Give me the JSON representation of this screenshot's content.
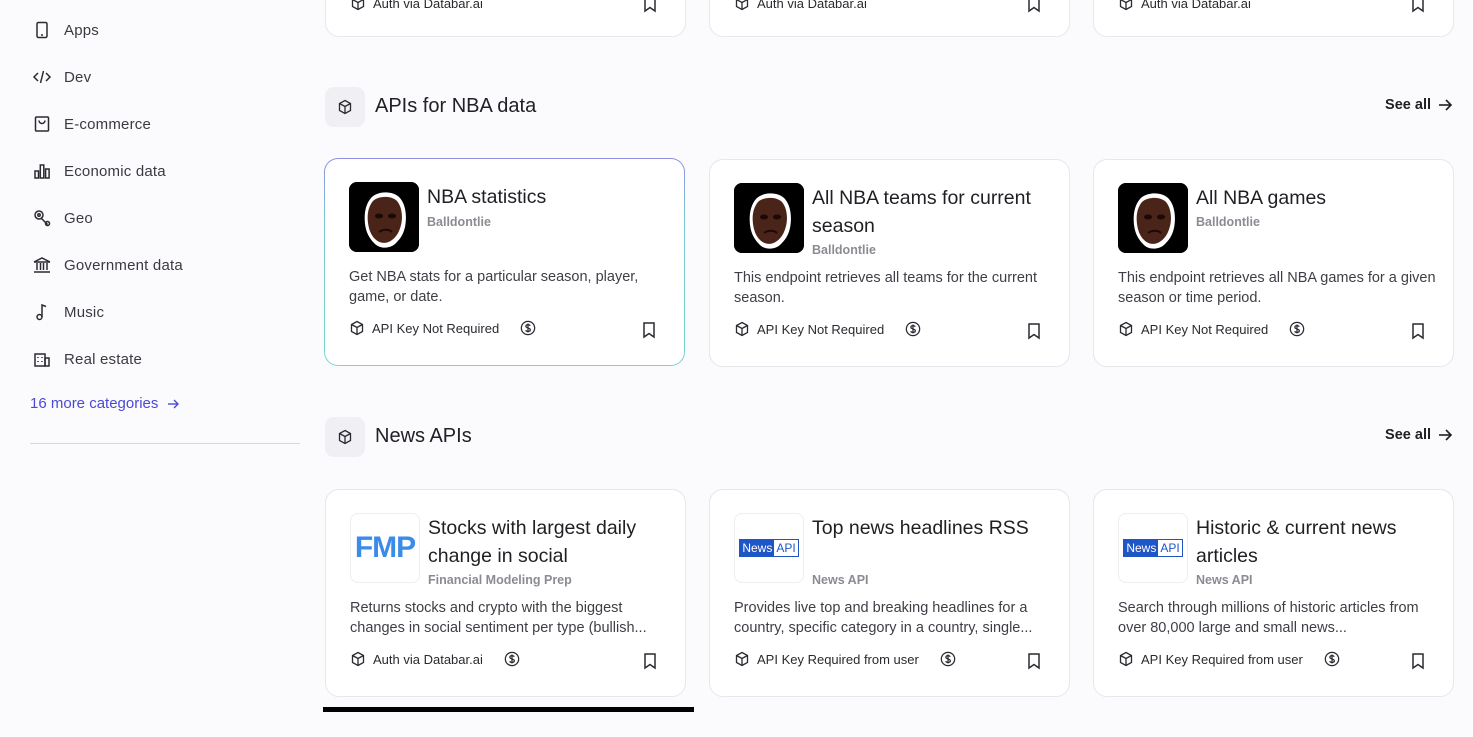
{
  "sidebar": {
    "categories": [
      {
        "label": "Apps",
        "icon": "phone-icon"
      },
      {
        "label": "Dev",
        "icon": "code-icon"
      },
      {
        "label": "E-commerce",
        "icon": "shopping-bag-icon"
      },
      {
        "label": "Economic data",
        "icon": "bar-chart-icon"
      },
      {
        "label": "Geo",
        "icon": "map-pin-icon"
      },
      {
        "label": "Government data",
        "icon": "bank-icon"
      },
      {
        "label": "Music",
        "icon": "music-note-icon"
      },
      {
        "label": "Real estate",
        "icon": "building-icon"
      }
    ],
    "more_label": "16 more categories"
  },
  "top_row": {
    "meta_label": "Auth via Databar.ai"
  },
  "sections": [
    {
      "title": "APIs for NBA data",
      "see_all": "See all",
      "cards": [
        {
          "title": "NBA statistics",
          "provider": "Balldontlie",
          "description": "Get NBA stats for a particular season, player, game, or date.",
          "auth": "API Key Not Required"
        },
        {
          "title": "All NBA teams for current season",
          "provider": "Balldontlie",
          "description": "This endpoint retrieves all teams for the current season.",
          "auth": "API Key Not Required"
        },
        {
          "title": "All NBA games",
          "provider": "Balldontlie",
          "description": "This endpoint retrieves all NBA games for a given season or time period.",
          "auth": "API Key Not Required"
        }
      ]
    },
    {
      "title": "News APIs",
      "see_all": "See all",
      "cards": [
        {
          "title": "Stocks with largest daily change in social",
          "provider": "Financial Modeling Prep",
          "description": "Returns stocks and crypto with the biggest changes in social sentiment per type (bullish...",
          "auth": "Auth via Databar.ai",
          "logo_text": "FMP"
        },
        {
          "title": "Top news headlines RSS",
          "provider": "News API",
          "description": "Provides live top and breaking headlines for a country, specific category in a country, single...",
          "auth": "API Key Required from user",
          "logo_a": "News",
          "logo_b": "API"
        },
        {
          "title": "Historic & current news articles",
          "provider": "News API",
          "description": "Search through millions of historic articles from over 80,000 large and small news...",
          "auth": "API Key Required from user",
          "logo_a": "News",
          "logo_b": "API"
        }
      ]
    }
  ],
  "colors": {
    "accent": "#4b49d6",
    "news_blue": "#1f56c6",
    "fmp_blue": "#3b8be8"
  }
}
